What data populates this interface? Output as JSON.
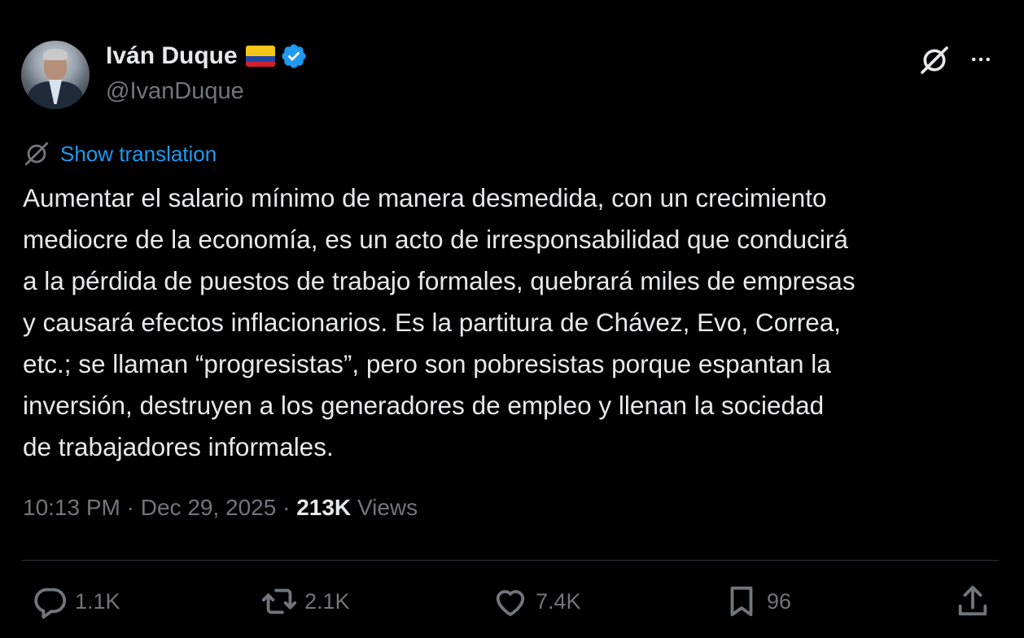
{
  "author": {
    "display_name": "Iván Duque",
    "handle": "@IvanDuque",
    "verified": true
  },
  "translation_link": "Show translation",
  "tweet_text": "Aumentar el salario mínimo de manera desmedida, con un crecimiento\nmediocre de la economía, es un acto de irresponsabilidad que conducirá\na la pérdida de puestos de trabajo formales, quebrará miles de empresas\ny causará efectos inflacionarios. Es la partitura de Chávez, Evo, Correa,\netc.; se llaman “progresistas”, pero son pobresistas porque espantan la\ninversión, destruyen a los generadores de empleo y llenan la sociedad\nde trabajadores informales.",
  "meta": {
    "time": "10:13 PM",
    "separator": "·",
    "date": "Dec 29, 2025",
    "views_count": "213K",
    "views_label": "Views"
  },
  "actions": {
    "replies": "1.1K",
    "reposts": "2.1K",
    "likes": "7.4K",
    "bookmarks": "96"
  },
  "colors": {
    "background": "#000000",
    "text": "#e7e9ea",
    "muted": "#71767b",
    "link": "#1d9bf0",
    "verified": "#1d9bf0",
    "divider": "#2f3336"
  },
  "icons": [
    "grok-icon",
    "more-icon",
    "translate-icon",
    "reply-icon",
    "repost-icon",
    "like-icon",
    "bookmark-icon",
    "share-icon",
    "verified-badge-icon",
    "colombia-flag-icon"
  ]
}
